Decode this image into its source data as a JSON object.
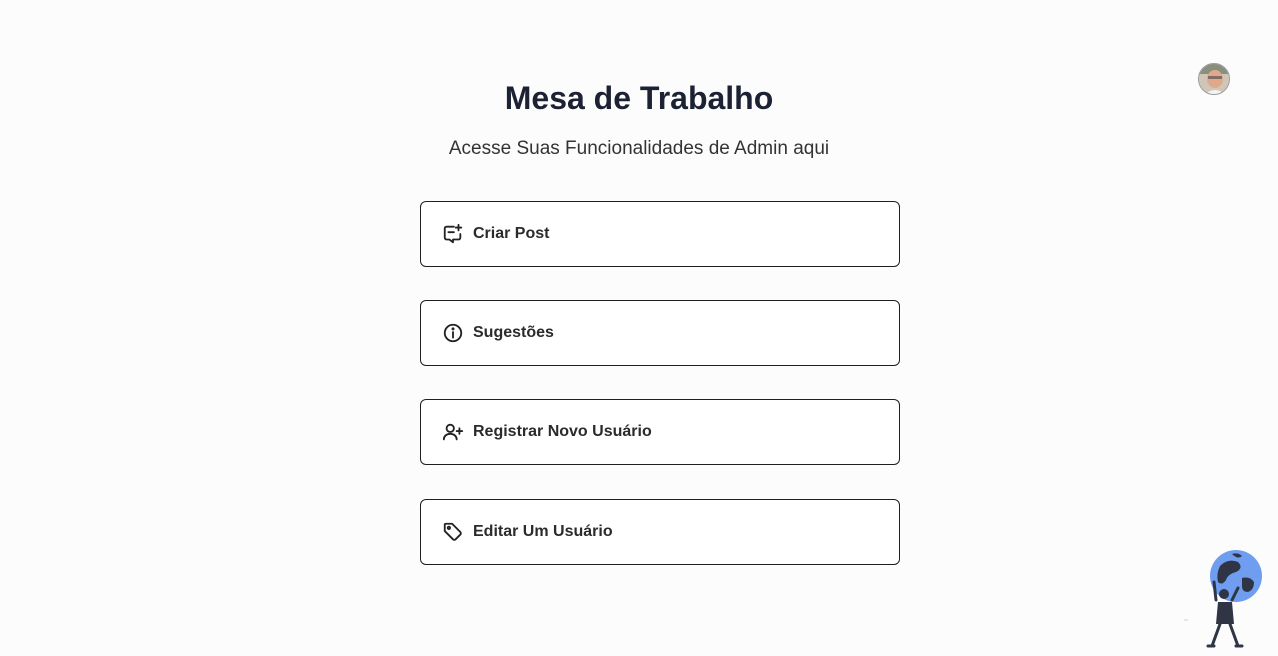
{
  "header": {
    "title": "Mesa de Trabalho",
    "subtitle": "Acesse Suas Funcionalidades de Admin aqui"
  },
  "menu": {
    "items": [
      {
        "label": "Criar Post",
        "icon": "message-plus-icon"
      },
      {
        "label": "Sugestões",
        "icon": "info-icon"
      },
      {
        "label": "Registrar Novo Usuário",
        "icon": "user-plus-icon"
      },
      {
        "label": "Editar Um Usuário",
        "icon": "tag-icon"
      }
    ]
  },
  "colors": {
    "background": "#fcfcfc",
    "title": "#1c2233",
    "border": "#1f1f1f",
    "globe": "#6f9df0"
  }
}
